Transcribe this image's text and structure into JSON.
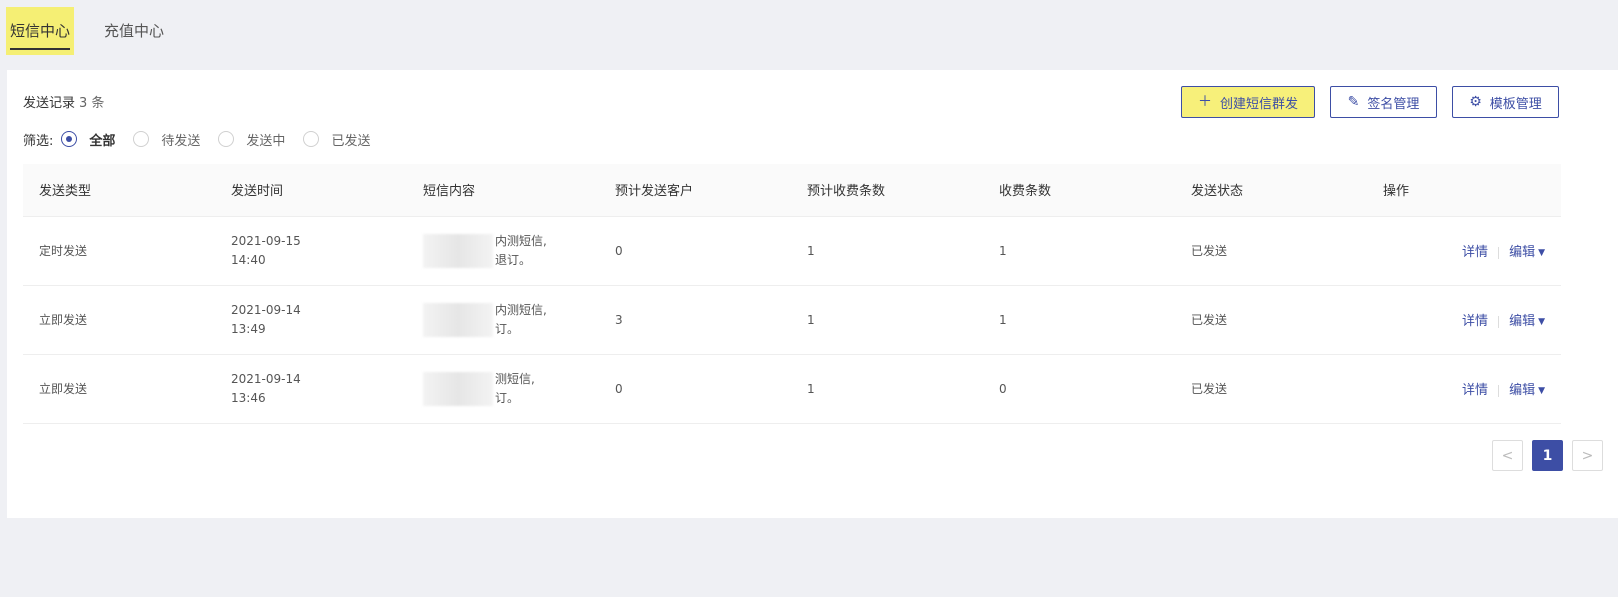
{
  "tabs": [
    {
      "label": "短信中心",
      "active": true
    },
    {
      "label": "充值中心",
      "active": false
    }
  ],
  "records": {
    "title": "发送记录",
    "count_text": "3 条"
  },
  "actions": {
    "create_label": "创建短信群发",
    "signature_label": "签名管理",
    "template_label": "模板管理"
  },
  "filter": {
    "label": "筛选:",
    "options": [
      {
        "label": "全部",
        "checked": true
      },
      {
        "label": "待发送",
        "checked": false
      },
      {
        "label": "发送中",
        "checked": false
      },
      {
        "label": "已发送",
        "checked": false
      }
    ]
  },
  "table": {
    "headers": [
      "发送类型",
      "发送时间",
      "短信内容",
      "预计发送客户",
      "预计收费条数",
      "收费条数",
      "发送状态",
      "操作"
    ],
    "rows": [
      {
        "type": "定时发送",
        "date": "2021-09-15",
        "time": "14:40",
        "content_line1": "内测短信,",
        "content_line2": "退订。",
        "est_customers": "0",
        "est_billing": "1",
        "billing": "1",
        "status": "已发送",
        "op_detail": "详情",
        "op_edit": "编辑"
      },
      {
        "type": "立即发送",
        "date": "2021-09-14",
        "time": "13:49",
        "content_line1": "内测短信,",
        "content_line2": "订。",
        "est_customers": "3",
        "est_billing": "1",
        "billing": "1",
        "status": "已发送",
        "op_detail": "详情",
        "op_edit": "编辑"
      },
      {
        "type": "立即发送",
        "date": "2021-09-14",
        "time": "13:46",
        "content_line1": "测短信,",
        "content_line2": "订。",
        "est_customers": "0",
        "est_billing": "1",
        "billing": "0",
        "status": "已发送",
        "op_detail": "详情",
        "op_edit": "编辑"
      }
    ]
  },
  "pagination": {
    "prev": "<",
    "current": "1",
    "next": ">"
  },
  "colors": {
    "accent": "#3d4ea5",
    "highlight": "#f5ef74"
  }
}
